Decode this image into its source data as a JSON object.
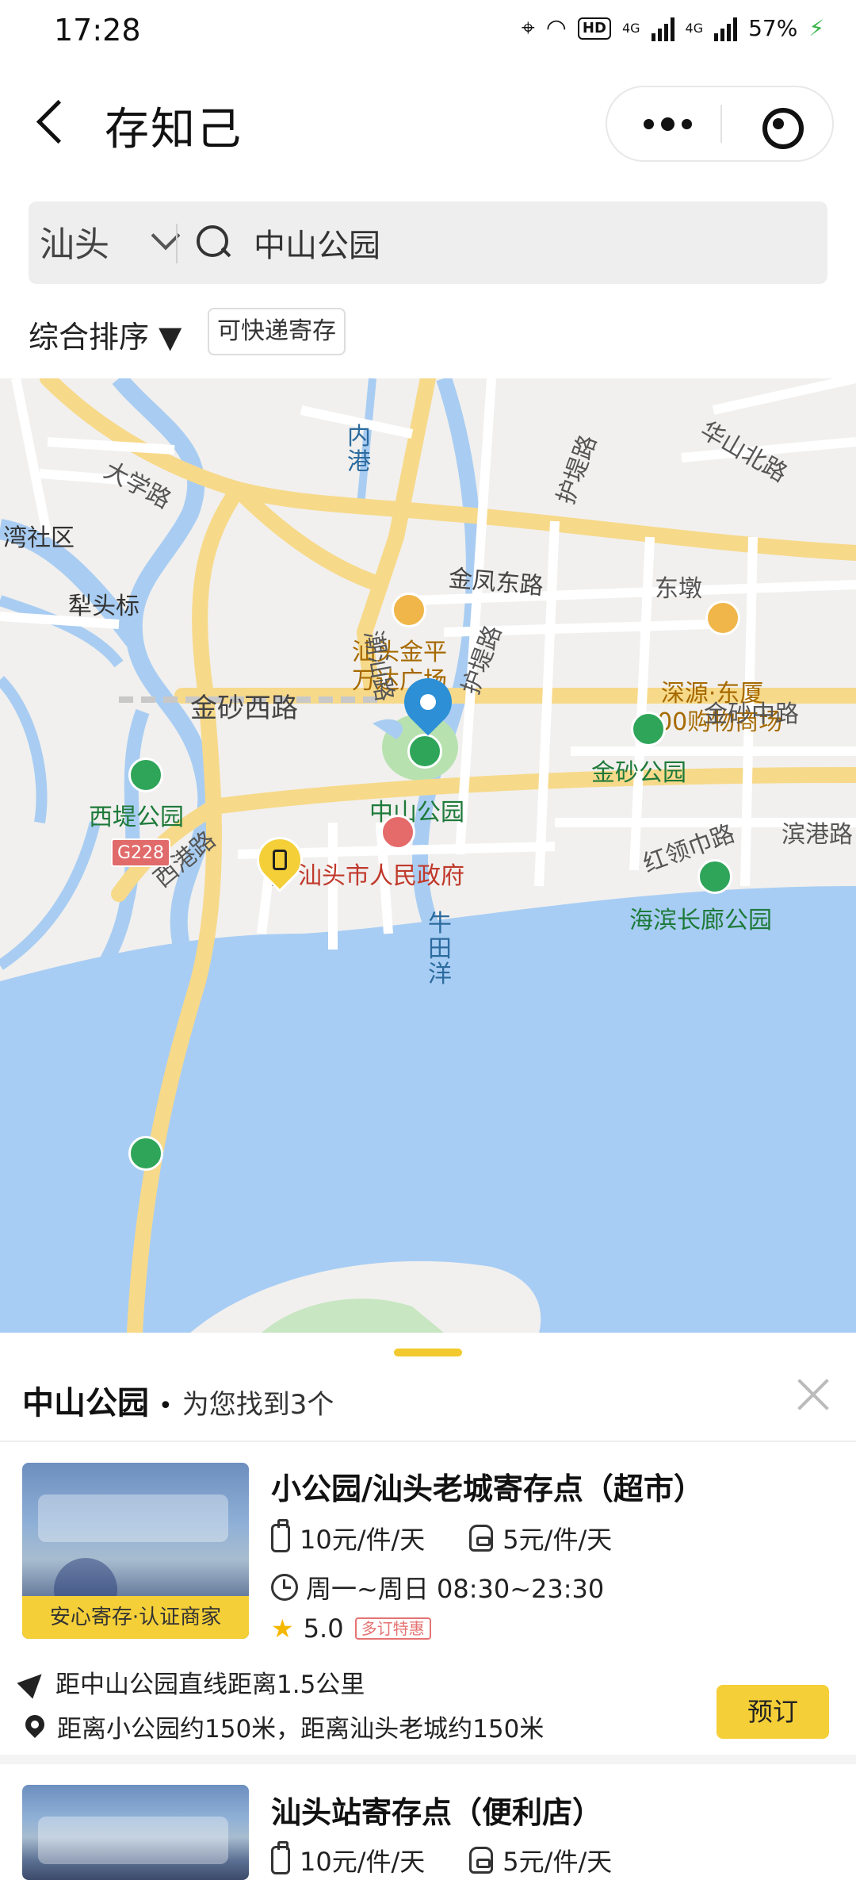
{
  "status_bar": {
    "time": "17:28",
    "battery": "57%",
    "network_1": "4G",
    "network_2": "4G",
    "hd": "HD"
  },
  "header": {
    "title": "存知己"
  },
  "search": {
    "city": "汕头",
    "query": "中山公园"
  },
  "filters": {
    "sort_label": "综合排序 ▼",
    "express_tag": "可快递寄存"
  },
  "map": {
    "labels": {
      "daxue_road": "大学路",
      "neigang": "内港",
      "hudi_road_1": "护堤路",
      "huashan_north": "华山北路",
      "wanshequ": "湾社区",
      "jinfeng_east": "金凤东路",
      "dongdun": "东墩",
      "wanda": "汕头金平\n万达广场",
      "dongxia": "深源·东厦\n100购物商场",
      "litoubiao": "犁头标",
      "chaoshan_road": "潮汕路",
      "hudi_road_2": "护堤路",
      "jinsha_west": "金砂西路",
      "jinsha_middle": "金砂中路",
      "jinsha_park": "金砂公园",
      "zhongshan_park": "中山公园",
      "xigang_road": "西港路",
      "gov": "汕头市人民政府",
      "hongling_road": "红领巾路",
      "binggang_road": "滨港路",
      "haibin_park": "海滨长廊公园",
      "niutianyang": "牛\n田\n洋",
      "xidi_park": "西堤公园",
      "g228": "G228"
    }
  },
  "sheet": {
    "place": "中山公园",
    "dot": "•",
    "count_text": "为您找到3个",
    "stores": [
      {
        "name": "小公园/汕头老城寄存点（超市）",
        "badge": "安心寄存·认证商家",
        "price_luggage": "10元/件/天",
        "price_bag": "5元/件/天",
        "hours": "周一~周日 08:30~23:30",
        "rating": "5.0",
        "promo_tag": "多订特惠",
        "distance": "距中山公园直线距离1.5公里",
        "location": "距离小公园约150米，距离汕头老城约150米",
        "book_label": "预订"
      },
      {
        "name": "汕头站寄存点（便利店）",
        "price_luggage": "10元/件/天",
        "price_bag": "5元/件/天"
      }
    ]
  }
}
